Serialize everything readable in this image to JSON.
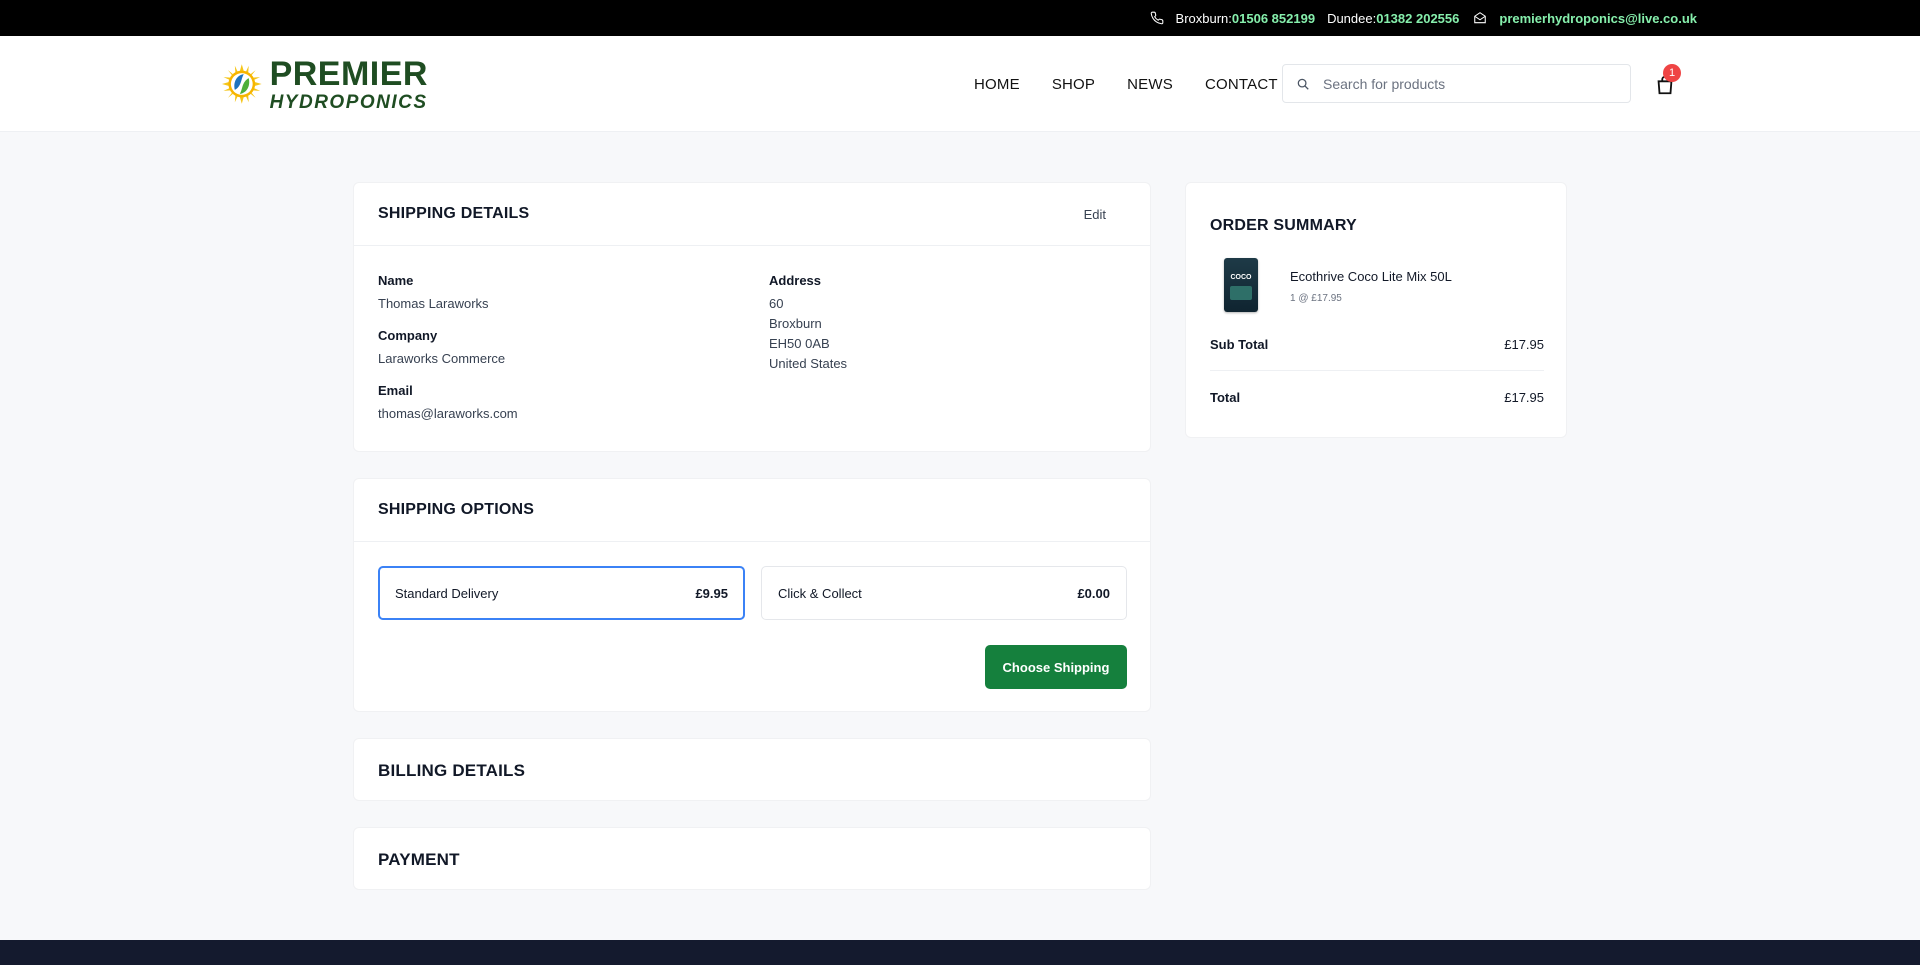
{
  "topbar": {
    "broxburn_label": "Broxburn:",
    "broxburn_phone": "01506 852199",
    "dundee_label": "Dundee:",
    "dundee_phone": "01382 202556",
    "email": "premierhydroponics@live.co.uk",
    "phone_icon": "phone-icon",
    "mail_icon": "mail-icon"
  },
  "header": {
    "logo_line1": "PREMIER",
    "logo_line2": "HYDROPONICS",
    "nav": [
      "HOME",
      "SHOP",
      "NEWS",
      "CONTACT"
    ],
    "search_placeholder": "Search for products",
    "cart_count": "1"
  },
  "shipping_details": {
    "title": "SHIPPING DETAILS",
    "edit_label": "Edit",
    "name_label": "Name",
    "name_value": "Thomas Laraworks",
    "company_label": "Company",
    "company_value": "Laraworks Commerce",
    "email_label": "Email",
    "email_value": "thomas@laraworks.com",
    "address_label": "Address",
    "address_lines": [
      "60",
      "Broxburn",
      "EH50 0AB",
      "United States"
    ]
  },
  "shipping_options": {
    "title": "SHIPPING OPTIONS",
    "options": [
      {
        "label": "Standard Delivery",
        "price": "£9.95",
        "selected": true
      },
      {
        "label": "Click & Collect",
        "price": "£0.00",
        "selected": false
      }
    ],
    "choose_label": "Choose Shipping"
  },
  "billing": {
    "title": "BILLING DETAILS"
  },
  "payment": {
    "title": "PAYMENT"
  },
  "order_summary": {
    "title": "ORDER SUMMARY",
    "product_name": "Ecothrive Coco Lite Mix 50L",
    "product_qty": "1 @ £17.95",
    "product_thumb_text": "COCO",
    "subtotal_label": "Sub Total",
    "subtotal_value": "£17.95",
    "total_label": "Total",
    "total_value": "£17.95"
  },
  "colors": {
    "accent_green": "#15803d",
    "link_green": "#86efac",
    "selected_blue": "#3b82f6",
    "badge_red": "#ef4444",
    "footer": "#141a2e"
  }
}
